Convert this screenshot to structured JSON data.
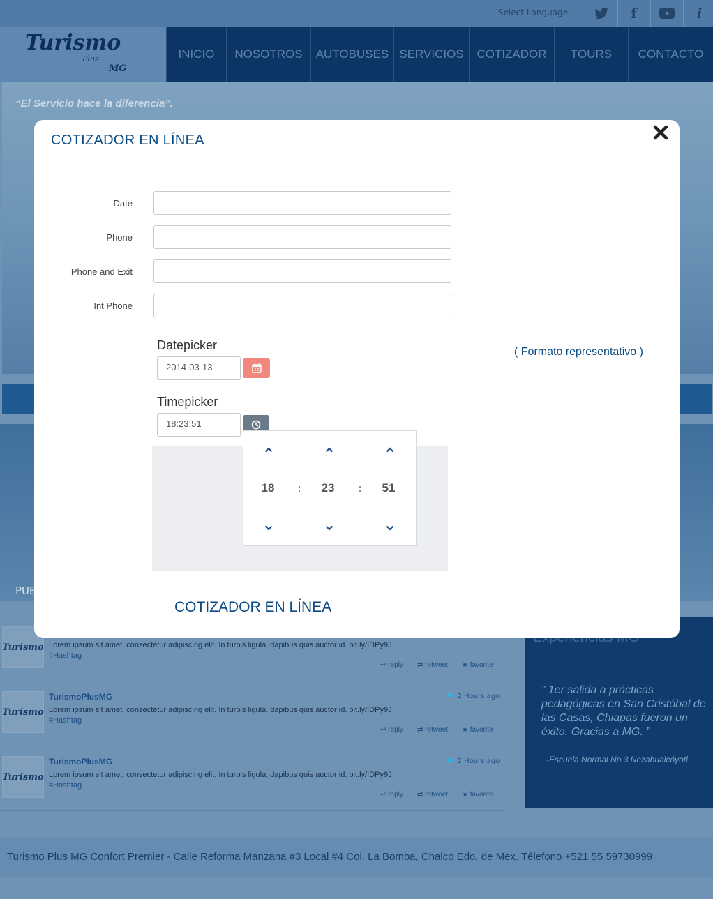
{
  "header": {
    "language_label": "Select Language",
    "social": {
      "twitter": "twitter-icon",
      "facebook": "f",
      "youtube": "youtube-icon",
      "info": "i"
    },
    "logo": {
      "main": "Turismo",
      "sub": "Plus",
      "mg": "MG"
    },
    "nav": [
      "INICIO",
      "NOSOTROS",
      "AUTOBUSES",
      "SERVICIOS",
      "COTIZADOR",
      "TOURS",
      "CONTACTO"
    ]
  },
  "hero": {
    "slogan": "“El Servicio hace la diferencia”."
  },
  "mid": {
    "caption": "PUE"
  },
  "tweets": [
    {
      "user": "",
      "time": "",
      "text": "Lorem ipsum  sit amet, consectetur adipiscing elit. In turpis ligula, dapibus quis auctor id. bit.ly/IDPy9J",
      "hashtag": "#Hashtag",
      "actions": [
        "reply",
        "retweet",
        "favorite"
      ]
    },
    {
      "user": "TurismoPlusMG",
      "time": "2 Hours ago",
      "text": "Lorem ipsum  sit amet, consectetur adipiscing elit. In turpis ligula, dapibus quis auctor id. bit.ly/IDPy9J",
      "hashtag": "#Hashtag",
      "actions": [
        "reply",
        "retweet",
        "favorite"
      ]
    },
    {
      "user": "TurismoPlusMG",
      "time": "2 Hours ago",
      "text": "Lorem ipsum  sit amet, consectetur adipiscing elit. In turpis ligula, dapibus quis auctor id. bit.ly/IDPy9J",
      "hashtag": "#Hashtag",
      "actions": [
        "reply",
        "retweet",
        "favorite"
      ]
    }
  ],
  "testimonial": {
    "title": "Experiencias MG",
    "quote": "” 1er salida a prácticas pedagógicas en San Cristóbal de las Casas, Chiapas fueron un éxito. Gracias a MG. ”",
    "author": "-Escuela Normal No.3 Nezahualcóyotl"
  },
  "footer": {
    "text": "Turismo Plus MG Confort Premier - Calle Reforma Manzana #3 Local #4 Col. La Bomba, Chalco Edo. de Mex. Télefono +521 55 59730999"
  },
  "modal": {
    "title": "COTIZADOR EN LÍNEA",
    "close_icon": "close-icon",
    "fields": [
      {
        "label": "Date",
        "value": ""
      },
      {
        "label": "Phone",
        "value": ""
      },
      {
        "label": "Phone and Exit",
        "value": ""
      },
      {
        "label": "Int Phone",
        "value": ""
      }
    ],
    "datepicker": {
      "label": "Datepicker",
      "value": "2014-03-13",
      "icon": "calendar-icon"
    },
    "timepicker": {
      "label": "Timepicker",
      "value": "18:23:51",
      "icon": "clock-icon",
      "hours": "18",
      "minutes": "23",
      "seconds": "51",
      "separator": ":"
    },
    "formato": "( Formato representativo )",
    "bottom_title": "COTIZADOR EN LÍNEA"
  },
  "colors": {
    "accent": "#0b4a82",
    "calendar_button": "#f0887d",
    "clock_button": "#6b7a88",
    "overlay": "#6f93b4"
  }
}
